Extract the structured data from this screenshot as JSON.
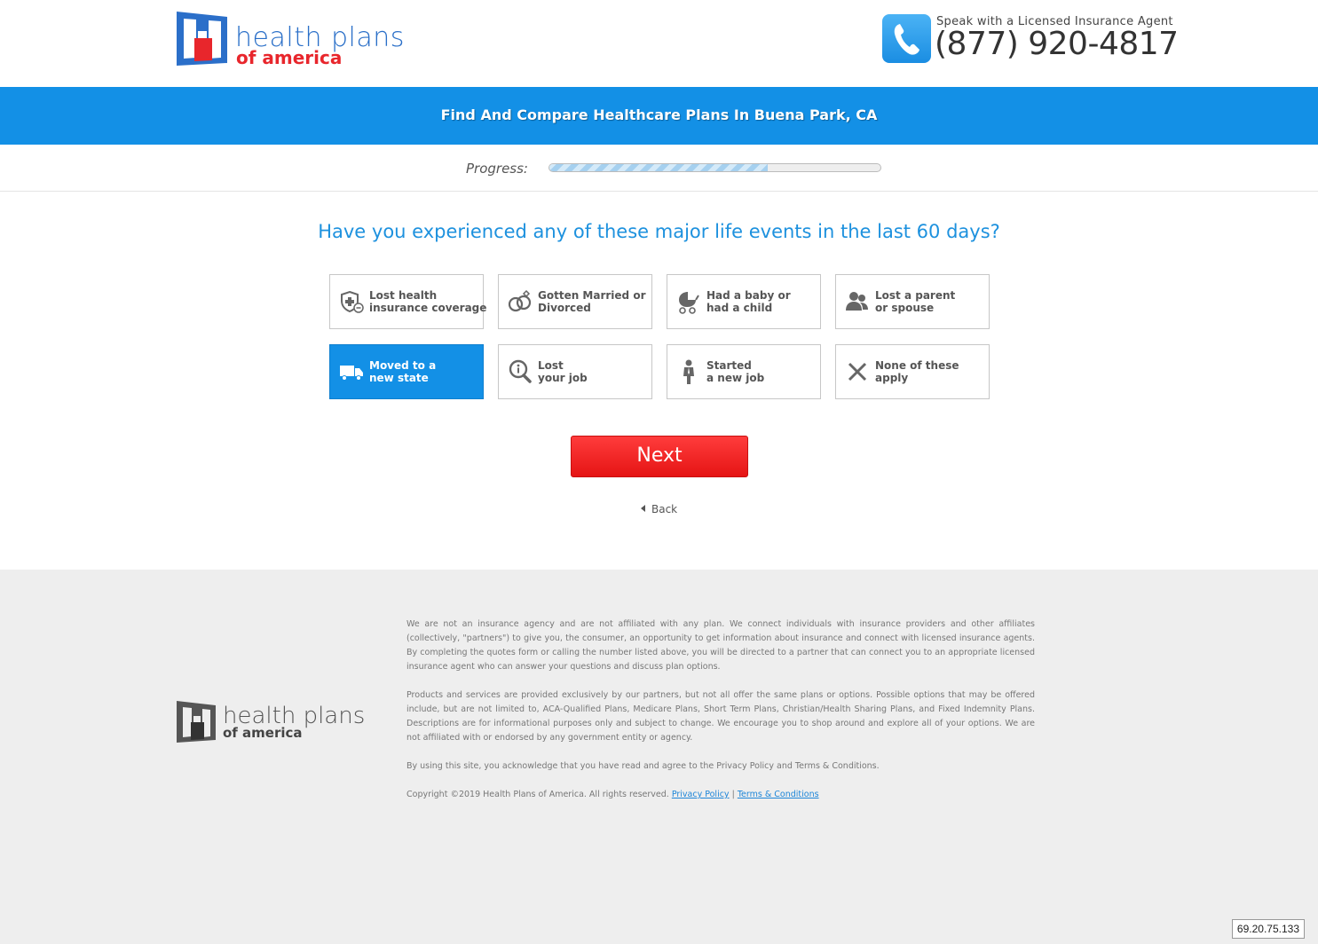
{
  "header": {
    "logo_word1": "health plans",
    "logo_word2": "of america",
    "agent_label": "Speak with a Licensed Insurance Agent",
    "phone": "(877) 920-4817"
  },
  "banner": {
    "title": "Find And Compare Healthcare Plans In Buena Park, CA"
  },
  "progress": {
    "label": "Progress:",
    "value": 0.66
  },
  "question": "Have you experienced any of these major life events in the last 60 days?",
  "options": [
    {
      "line1": "Lost health",
      "line2": "insurance coverage",
      "icon": "shield-medical-icon",
      "selected": false
    },
    {
      "line1": "Gotten Married or",
      "line2": "Divorced",
      "icon": "rings-icon",
      "selected": false
    },
    {
      "line1": "Had a baby or",
      "line2": "had a child",
      "icon": "baby-carriage-icon",
      "selected": false
    },
    {
      "line1": "Lost a parent",
      "line2": "or spouse",
      "icon": "people-icon",
      "selected": false
    },
    {
      "line1": "Moved to a",
      "line2": "new state",
      "icon": "moving-truck-icon",
      "selected": true
    },
    {
      "line1": "Lost",
      "line2": "your job",
      "icon": "magnifier-info-icon",
      "selected": false
    },
    {
      "line1": "Started",
      "line2": "a new job",
      "icon": "businessman-icon",
      "selected": false
    },
    {
      "line1": "None of these",
      "line2": "apply",
      "icon": "x-icon",
      "selected": false
    }
  ],
  "next_label": "Next",
  "back_label": "Back",
  "footer": {
    "logo_word1": "health plans",
    "logo_word2": "of america",
    "p1": "We are not an insurance agency and are not affiliated with any plan. We connect individuals with insurance providers and other affiliates (collectively, \"partners\") to give you, the consumer, an opportunity to get information about insurance and connect with licensed insurance agents. By completing the quotes form or calling the number listed above, you will be directed to a partner that can connect you to an appropriate licensed insurance agent who can answer your questions and discuss plan options.",
    "p2": "Products and services are provided exclusively by our partners, but not all offer the same plans or options. Possible options that may be offered include, but are not limited to, ACA-Qualified Plans, Medicare Plans, Short Term Plans, Christian/Health Sharing Plans, and Fixed Indemnity Plans. Descriptions are for informational purposes only and subject to change. We encourage you to shop around and explore all of your options. We are not affiliated with or endorsed by any government entity or agency.",
    "p3": "By using this site, you acknowledge that you have read and agree to the Privacy Policy and Terms & Conditions.",
    "copyright": "Copyright ©2019 Health Plans of America. All rights reserved.",
    "privacy_link": "Privacy Policy",
    "separator": "|",
    "terms_link": "Terms & Conditions"
  },
  "ip_badge": "69.20.75.133",
  "colors": {
    "brand_blue": "#1390e6",
    "brand_red": "#e51414",
    "question_blue": "#1d91de"
  }
}
